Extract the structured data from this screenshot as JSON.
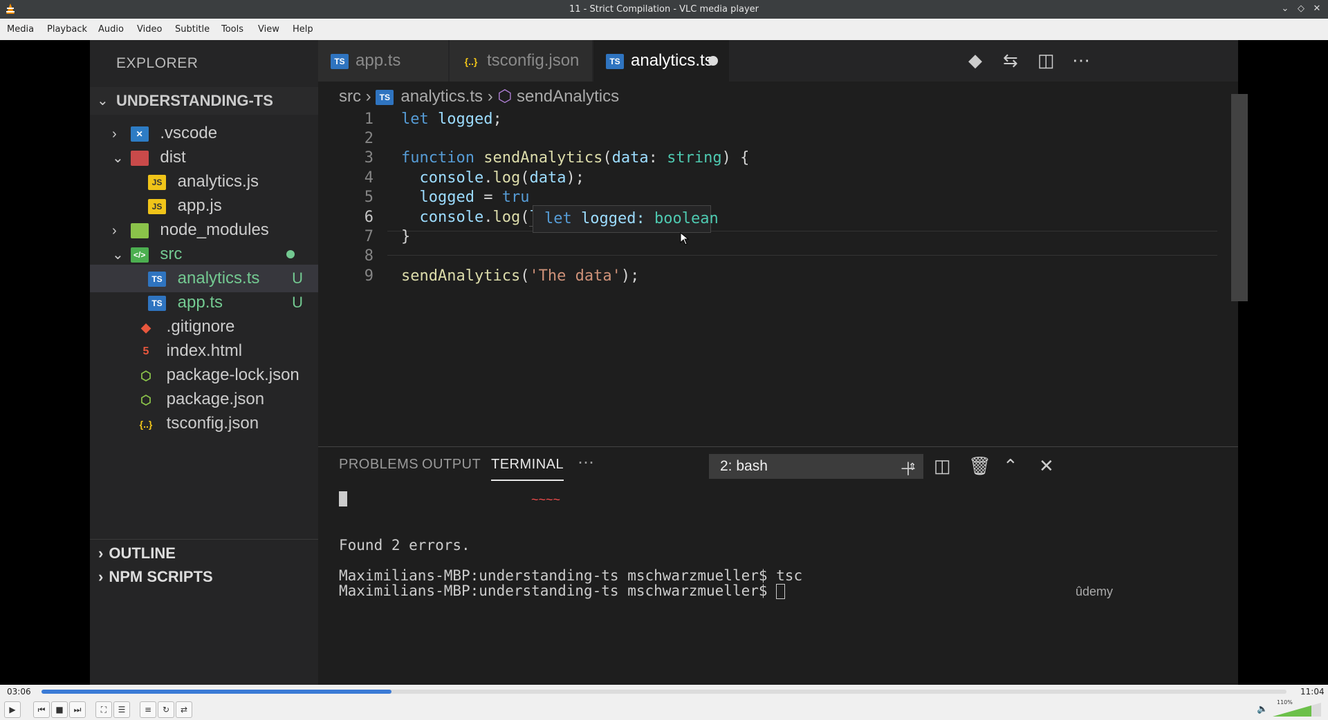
{
  "window": {
    "title": "11 - Strict Compilation - VLC media player",
    "controls": [
      "minimize-icon",
      "restore-icon",
      "close-icon"
    ]
  },
  "menu": [
    "Media",
    "Playback",
    "Audio",
    "Video",
    "Subtitle",
    "Tools",
    "View",
    "Help"
  ],
  "vscode": {
    "explorer_title": "EXPLORER",
    "project": "UNDERSTANDING-TS",
    "tree": [
      {
        "label": ".vscode",
        "badge": ""
      },
      {
        "label": "dist",
        "badge": ""
      },
      {
        "label": "analytics.js",
        "badge": ""
      },
      {
        "label": "app.js",
        "badge": ""
      },
      {
        "label": "node_modules",
        "badge": ""
      },
      {
        "label": "src",
        "badge": ""
      },
      {
        "label": "analytics.ts",
        "badge": "U"
      },
      {
        "label": "app.ts",
        "badge": "U"
      },
      {
        "label": ".gitignore",
        "badge": ""
      },
      {
        "label": "index.html",
        "badge": ""
      },
      {
        "label": "package-lock.json",
        "badge": ""
      },
      {
        "label": "package.json",
        "badge": ""
      },
      {
        "label": "tsconfig.json",
        "badge": ""
      }
    ],
    "outline": "OUTLINE",
    "npm_scripts": "NPM SCRIPTS",
    "tabs": [
      {
        "label": "app.ts",
        "icon": "TS"
      },
      {
        "label": "tsconfig.json",
        "icon": "{..}"
      },
      {
        "label": "analytics.ts",
        "icon": "TS"
      }
    ],
    "breadcrumb": {
      "folder": "src",
      "file": "analytics.ts",
      "symbol": "sendAnalytics"
    },
    "line_numbers": [
      "1",
      "2",
      "3",
      "4",
      "5",
      "6",
      "7",
      "8",
      "9"
    ],
    "hover": {
      "kw": "let",
      "name": "logged:",
      "type": "boolean"
    },
    "panel_tabs": [
      "PROBLEMS",
      "OUTPUT",
      "TERMINAL"
    ],
    "terminal_select": "2: bash",
    "terminal_lines": [
      "Found 2 errors.",
      "Maximilians-MBP:understanding-ts mschwarzmueller$ tsc",
      "Maximilians-MBP:understanding-ts mschwarzmueller$ "
    ],
    "watermark": "ûdemy"
  },
  "player": {
    "elapsed": "03:06",
    "total": "11:04",
    "progress_fraction": 0.281,
    "volume_label": "110%",
    "volume_fraction": 0.8
  }
}
